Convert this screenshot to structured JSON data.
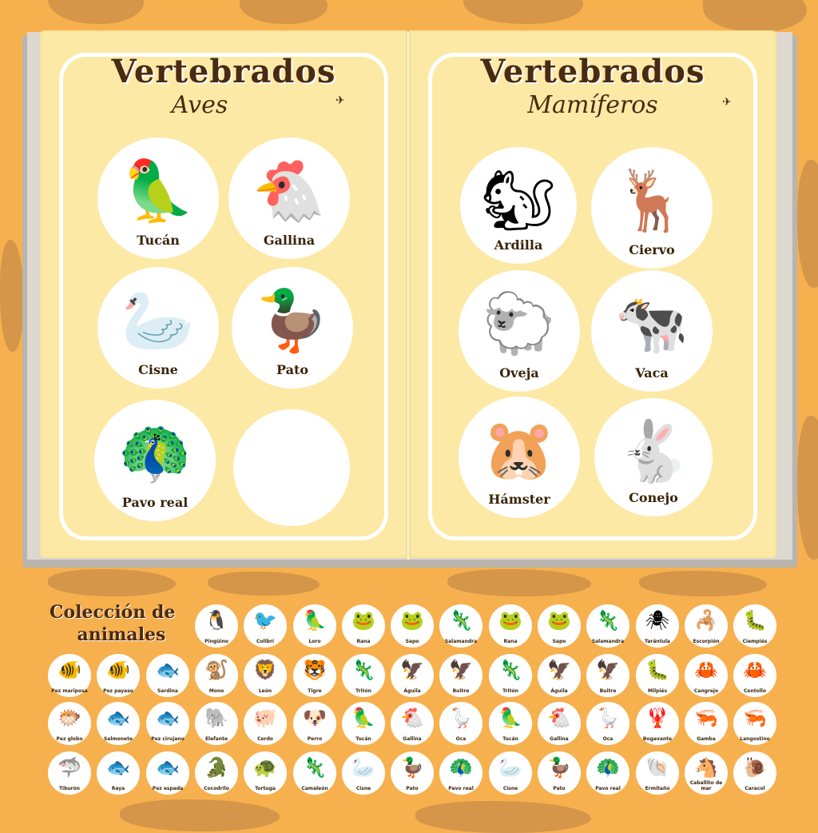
{
  "left_page": {
    "title": "Vertebrados",
    "subtitle": "Aves",
    "animals": [
      {
        "label": "Tucán",
        "icon": "toucan-icon",
        "emoji": "🦜"
      },
      {
        "label": "Gallina",
        "icon": "hen-icon",
        "emoji": "🐔"
      },
      {
        "label": "Cisne",
        "icon": "swan-icon",
        "emoji": "🦢"
      },
      {
        "label": "Pato",
        "icon": "duck-icon",
        "emoji": "🦆"
      },
      {
        "label": "Pavo real",
        "icon": "peacock-icon",
        "emoji": "🦚"
      },
      {
        "label": "",
        "icon": "empty-slot",
        "emoji": ""
      }
    ]
  },
  "right_page": {
    "title": "Vertebrados",
    "subtitle": "Mamíferos",
    "animals": [
      {
        "label": "Ardilla",
        "icon": "squirrel-icon",
        "emoji": "🐿"
      },
      {
        "label": "Ciervo",
        "icon": "deer-icon",
        "emoji": "🦌"
      },
      {
        "label": "Oveja",
        "icon": "sheep-icon",
        "emoji": "🐑"
      },
      {
        "label": "Vaca",
        "icon": "cow-icon",
        "emoji": "🐄"
      },
      {
        "label": "Hámster",
        "icon": "hamster-icon",
        "emoji": "🐹"
      },
      {
        "label": "Conejo",
        "icon": "rabbit-icon",
        "emoji": "🐇"
      }
    ]
  },
  "collection": {
    "title_line1": "Colección de",
    "title_line2": "animales",
    "rows": [
      [
        {
          "label": "Pingüino",
          "emoji": "🐧"
        },
        {
          "label": "Colibrí",
          "emoji": "🐦"
        },
        {
          "label": "Loro",
          "emoji": "🦜"
        },
        {
          "label": "Rana",
          "emoji": "🐸"
        },
        {
          "label": "Sapo",
          "emoji": "🐸"
        },
        {
          "label": "Salamandra",
          "emoji": "🦎"
        },
        {
          "label": "Rana",
          "emoji": "🐸"
        },
        {
          "label": "Sapo",
          "emoji": "🐸"
        },
        {
          "label": "Salamandra",
          "emoji": "🦎"
        },
        {
          "label": "Tarántula",
          "emoji": "🕷"
        },
        {
          "label": "Escorpión",
          "emoji": "🦂"
        },
        {
          "label": "Ciempiés",
          "emoji": "🐛"
        }
      ],
      [
        {
          "label": "Pez mariposa",
          "emoji": "🐠"
        },
        {
          "label": "Pez payaso",
          "emoji": "🐠"
        },
        {
          "label": "Sardina",
          "emoji": "🐟"
        },
        {
          "label": "Mono",
          "emoji": "🐒"
        },
        {
          "label": "León",
          "emoji": "🦁"
        },
        {
          "label": "Tigre",
          "emoji": "🐯"
        },
        {
          "label": "Tritón",
          "emoji": "🦎"
        },
        {
          "label": "Águila",
          "emoji": "🦅"
        },
        {
          "label": "Buitre",
          "emoji": "🦅"
        },
        {
          "label": "Tritón",
          "emoji": "🦎"
        },
        {
          "label": "Águila",
          "emoji": "🦅"
        },
        {
          "label": "Buitre",
          "emoji": "🦅"
        },
        {
          "label": "Milpiés",
          "emoji": "🐛"
        },
        {
          "label": "Cangrejo",
          "emoji": "🦀"
        },
        {
          "label": "Centollo",
          "emoji": "🦀"
        }
      ],
      [
        {
          "label": "Pez globo",
          "emoji": "🐡"
        },
        {
          "label": "Salmonete",
          "emoji": "🐟"
        },
        {
          "label": "Pez cirujano",
          "emoji": "🐟"
        },
        {
          "label": "Elefante",
          "emoji": "🐘"
        },
        {
          "label": "Cerdo",
          "emoji": "🐖"
        },
        {
          "label": "Perro",
          "emoji": "🐶"
        },
        {
          "label": "Tucán",
          "emoji": "🦜"
        },
        {
          "label": "Gallina",
          "emoji": "🐔"
        },
        {
          "label": "Oca",
          "emoji": "🪿"
        },
        {
          "label": "Tucán",
          "emoji": "🦜"
        },
        {
          "label": "Gallina",
          "emoji": "🐔"
        },
        {
          "label": "Oca",
          "emoji": "🪿"
        },
        {
          "label": "Bogavante",
          "emoji": "🦞"
        },
        {
          "label": "Gamba",
          "emoji": "🦐"
        },
        {
          "label": "Langostino",
          "emoji": "🦐"
        }
      ],
      [
        {
          "label": "Tiburón",
          "emoji": "🦈"
        },
        {
          "label": "Raya",
          "emoji": "🐟"
        },
        {
          "label": "Pez espada",
          "emoji": "🐟"
        },
        {
          "label": "Cocodrilo",
          "emoji": "🐊"
        },
        {
          "label": "Tortuga",
          "emoji": "🐢"
        },
        {
          "label": "Camaleón",
          "emoji": "🦎"
        },
        {
          "label": "Cisne",
          "emoji": "🦢"
        },
        {
          "label": "Pato",
          "emoji": "🦆"
        },
        {
          "label": "Pavo real",
          "emoji": "🦚"
        },
        {
          "label": "Cisne",
          "emoji": "🦢"
        },
        {
          "label": "Pato",
          "emoji": "🦆"
        },
        {
          "label": "Pavo real",
          "emoji": "🦚"
        },
        {
          "label": "Ermitaño",
          "emoji": "🐚"
        },
        {
          "label": "Caballito de mar",
          "emoji": "🐴"
        },
        {
          "label": "Caracol",
          "emoji": "🐌"
        }
      ]
    ]
  }
}
